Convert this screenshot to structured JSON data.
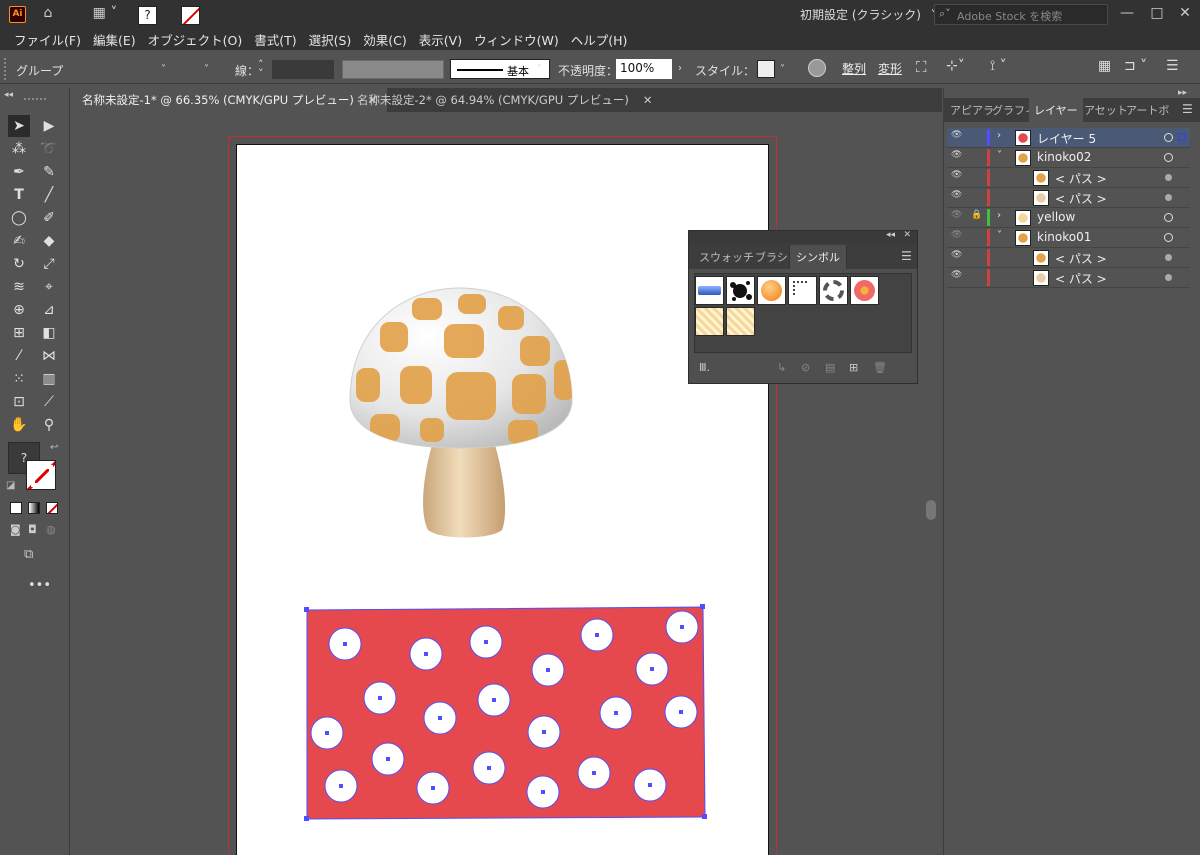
{
  "app": {
    "logo": "Ai",
    "preset": "初期設定 (クラシック)",
    "search_placeholder": "Adobe Stock を検索"
  },
  "menu": [
    "ファイル(F)",
    "編集(E)",
    "オブジェクト(O)",
    "書式(T)",
    "選択(S)",
    "効果(C)",
    "表示(V)",
    "ウィンドウ(W)",
    "ヘルプ(H)"
  ],
  "control": {
    "selection": "グループ",
    "stroke_label": "線：",
    "stroke_profile": "基本",
    "opacity_label": "不透明度：",
    "opacity_value": "100%",
    "style_label": "スタイル：",
    "align_label": "整列",
    "transform_label": "変形",
    "fill_value": "?"
  },
  "tabs": [
    {
      "label": "名称未設定-1* @ 66.35% (CMYK/GPU プレビュー)",
      "active": true
    },
    {
      "label": "名称未設定-2* @ 64.94% (CMYK/GPU プレビュー)",
      "active": false
    }
  ],
  "symbol_panel": {
    "tabs": [
      "スウォッチ",
      "ブラシ",
      "シンボル"
    ],
    "active_tab": "シンボル",
    "symbols": [
      "blue-bar",
      "ink-splat",
      "orange-button",
      "dotted-corner",
      "chain-ring",
      "pink-flower",
      "yellow-pattern-1",
      "yellow-pattern-2"
    ]
  },
  "right_panel": {
    "tabs": [
      "アピアラ",
      "グラフィ",
      "レイヤー",
      "アセット",
      "アートボ"
    ],
    "active_tab": "レイヤー",
    "layers": [
      {
        "name": "レイヤー 5",
        "level": 0,
        "expanded": false,
        "visible": true,
        "locked": false,
        "color": "#4f4fff",
        "selected": true
      },
      {
        "name": "kinoko02",
        "level": 0,
        "expanded": true,
        "visible": true,
        "locked": false,
        "color": "#d04040",
        "selected": false
      },
      {
        "name": "< パス >",
        "level": 1,
        "expanded": false,
        "visible": true,
        "locked": false,
        "color": "#d04040",
        "selected": false
      },
      {
        "name": "< パス >",
        "level": 1,
        "expanded": false,
        "visible": true,
        "locked": false,
        "color": "#d04040",
        "selected": false
      },
      {
        "name": "yellow",
        "level": 0,
        "expanded": false,
        "visible": false,
        "locked": true,
        "color": "#40c040",
        "selected": false
      },
      {
        "name": "kinoko01",
        "level": 0,
        "expanded": true,
        "visible": false,
        "locked": false,
        "color": "#d04040",
        "selected": false
      },
      {
        "name": "< パス >",
        "level": 1,
        "expanded": false,
        "visible": true,
        "locked": false,
        "color": "#d04040",
        "selected": false
      },
      {
        "name": "< パス >",
        "level": 1,
        "expanded": false,
        "visible": true,
        "locked": false,
        "color": "#d04040",
        "selected": false
      }
    ]
  },
  "colors": {
    "accent_red": "#e5484d",
    "selection_blue": "#4f4fff",
    "mushroom_spot": "#e2a24a",
    "mushroom_stem": "#e8cfa8"
  }
}
